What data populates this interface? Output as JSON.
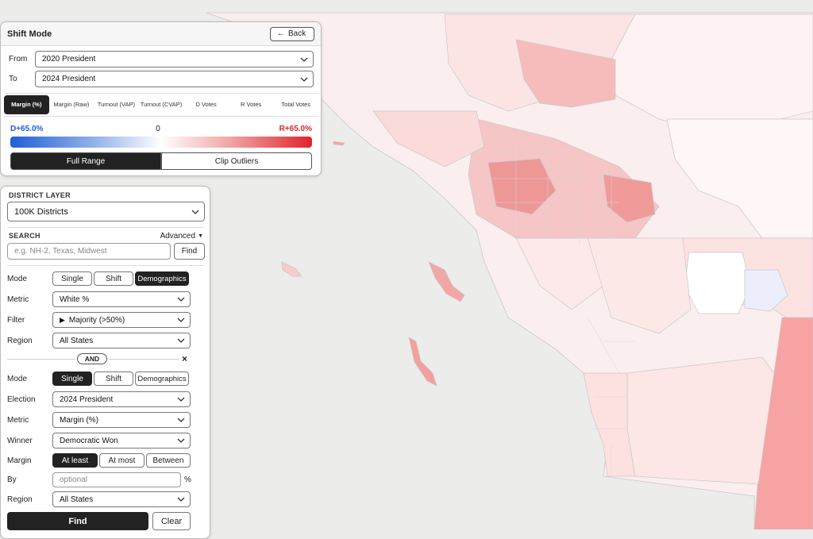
{
  "shift_panel": {
    "title": "Shift Mode",
    "back_label": "Back",
    "from_label": "From",
    "from_value": "2020 President",
    "to_label": "To",
    "to_value": "2024 President",
    "metrics": [
      {
        "label": "Margin (%)",
        "active": true
      },
      {
        "label": "Margin (Raw)",
        "active": false
      },
      {
        "label": "Turnout (VAP)",
        "active": false
      },
      {
        "label": "Turnout (CVAP)",
        "active": false
      },
      {
        "label": "D Votes",
        "active": false
      },
      {
        "label": "R Votes",
        "active": false
      },
      {
        "label": "Total Votes",
        "active": false
      }
    ],
    "scale_left": "D+65.0%",
    "scale_mid": "0",
    "scale_right": "R+65.0%",
    "range_full": "Full Range",
    "range_clip": "Clip Outliers",
    "colors": {
      "dem": "#1f5fd6",
      "rep": "#e0242b"
    }
  },
  "layer_panel": {
    "district_layer_title": "DISTRICT LAYER",
    "district_layer_value": "100K Districts",
    "search_title": "SEARCH",
    "advanced_label": "Advanced",
    "search_placeholder": "e.g. NH-2, Texas, Midwest",
    "find_label": "Find",
    "filter1": {
      "mode_label": "Mode",
      "modes": [
        "Single",
        "Shift",
        "Demographics"
      ],
      "active_mode": "Demographics",
      "metric_label": "Metric",
      "metric_value": "White %",
      "filter_label": "Filter",
      "filter_value": "Majority (>50%)",
      "region_label": "Region",
      "region_value": "All States"
    },
    "and_label": "AND",
    "close_label": "×",
    "filter2": {
      "mode_label": "Mode",
      "modes": [
        "Single",
        "Shift",
        "Demographics"
      ],
      "active_mode": "Single",
      "election_label": "Election",
      "election_value": "2024 President",
      "metric_label": "Metric",
      "metric_value": "Margin (%)",
      "winner_label": "Winner",
      "winner_value": "Democratic Won",
      "margin_label": "Margin",
      "margin_options": [
        "At least",
        "At most",
        "Between"
      ],
      "active_margin": "At least",
      "by_label": "By",
      "by_placeholder": "optional",
      "by_unit": "%",
      "region_label": "Region",
      "region_value": "All States"
    },
    "find_button": "Find",
    "clear_button": "Clear"
  }
}
